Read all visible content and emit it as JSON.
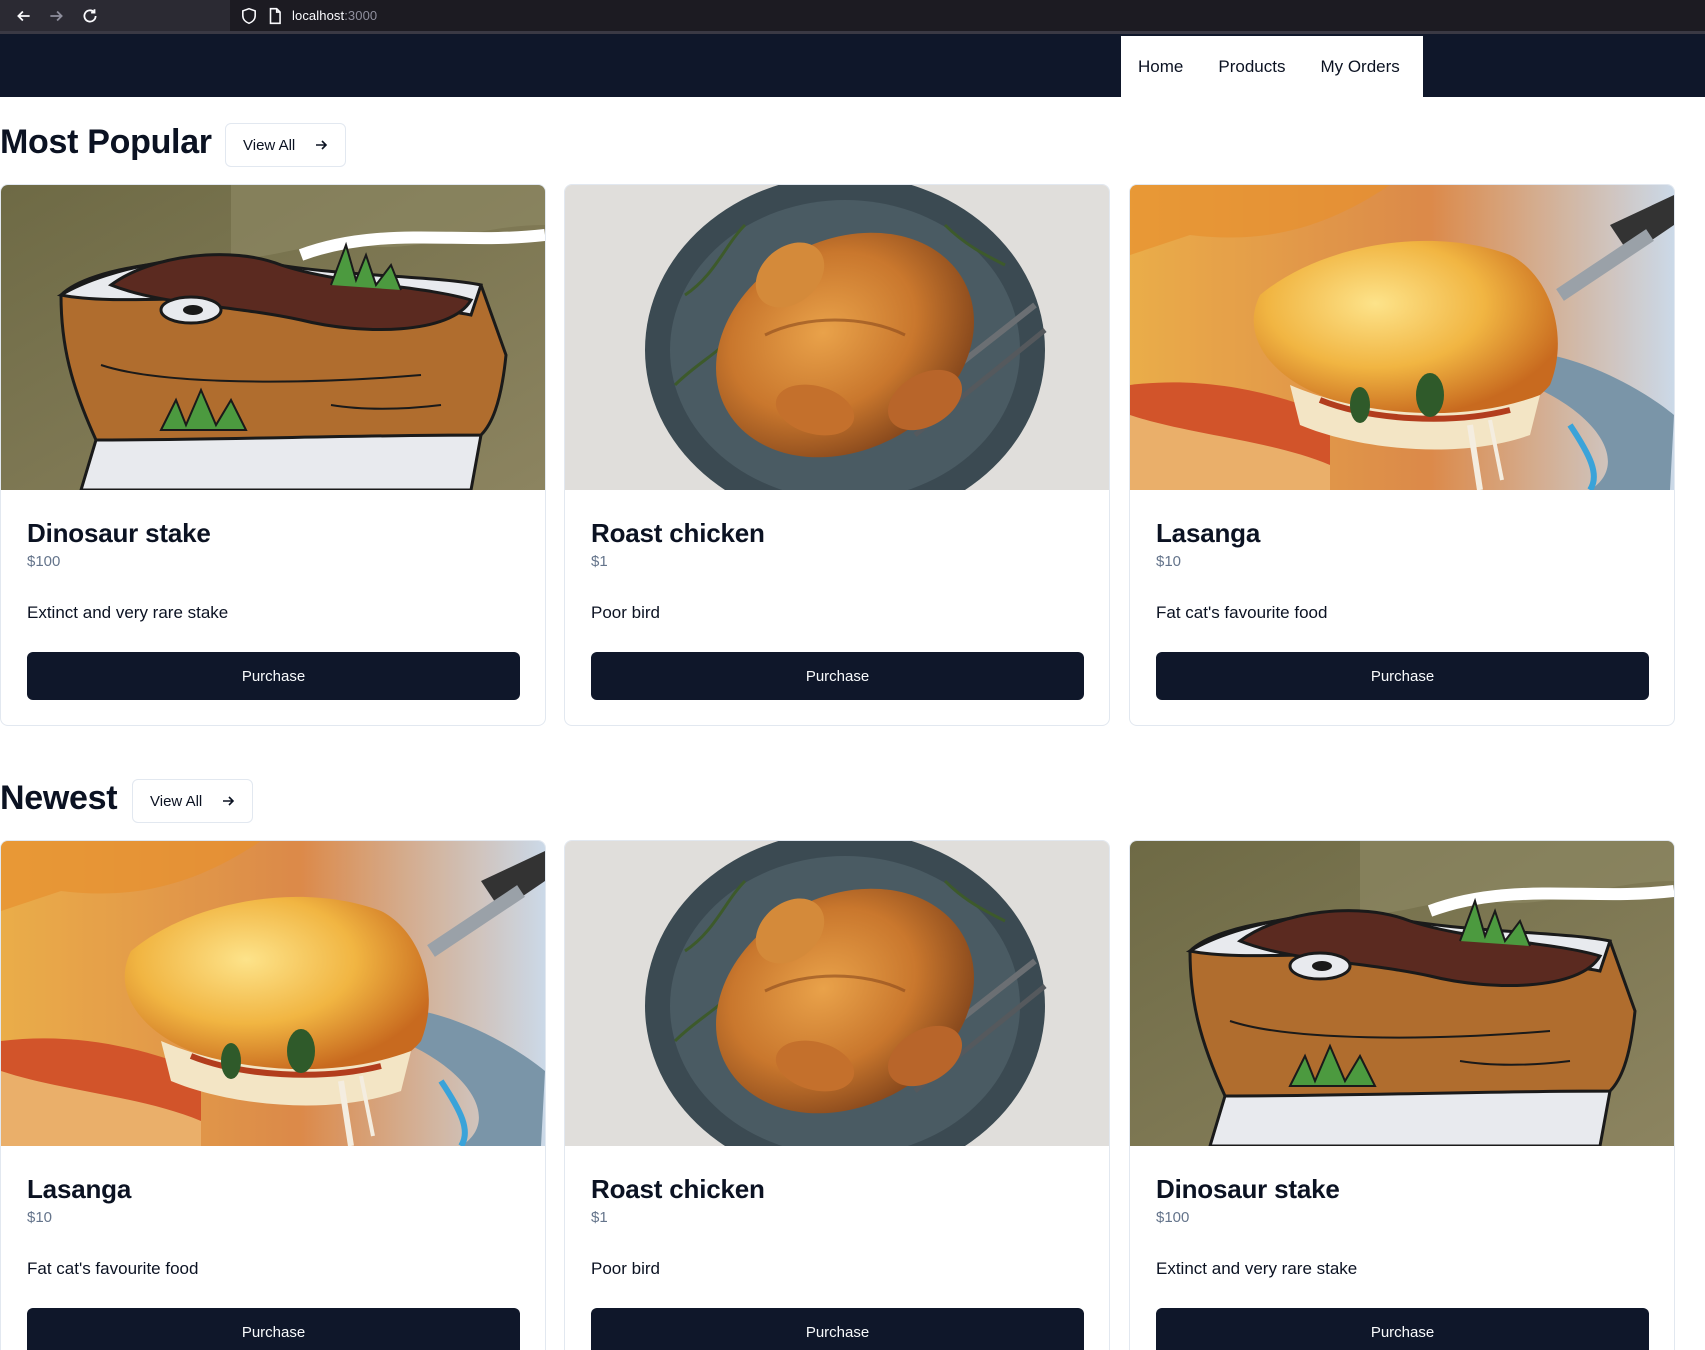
{
  "browser": {
    "url_host": "localhost",
    "url_port": ":3000"
  },
  "nav": {
    "home": "Home",
    "products": "Products",
    "orders": "My Orders"
  },
  "sections": [
    {
      "title": "Most Popular",
      "view_all": "View All",
      "products": [
        {
          "name": "Dinosaur stake",
          "price": "$100",
          "description": "Extinct and very rare stake",
          "button": "Purchase",
          "image": "dinosaur-steak-illustration"
        },
        {
          "name": "Roast chicken",
          "price": "$1",
          "description": "Poor bird",
          "button": "Purchase",
          "image": "roast-chicken-photo"
        },
        {
          "name": "Lasanga",
          "price": "$10",
          "description": "Fat cat's favourite food",
          "button": "Purchase",
          "image": "lasagna-photo"
        }
      ]
    },
    {
      "title": "Newest",
      "view_all": "View All",
      "products": [
        {
          "name": "Lasanga",
          "price": "$10",
          "description": "Fat cat's favourite food",
          "button": "Purchase",
          "image": "lasagna-photo"
        },
        {
          "name": "Roast chicken",
          "price": "$1",
          "description": "Poor bird",
          "button": "Purchase",
          "image": "roast-chicken-photo"
        },
        {
          "name": "Dinosaur stake",
          "price": "$100",
          "description": "Extinct and very rare stake",
          "button": "Purchase",
          "image": "dinosaur-steak-illustration"
        }
      ]
    }
  ],
  "colors": {
    "header_bg": "#0f172a",
    "button_bg": "#0f172a",
    "price_text": "#64748b",
    "card_border": "#e2e8f0"
  }
}
